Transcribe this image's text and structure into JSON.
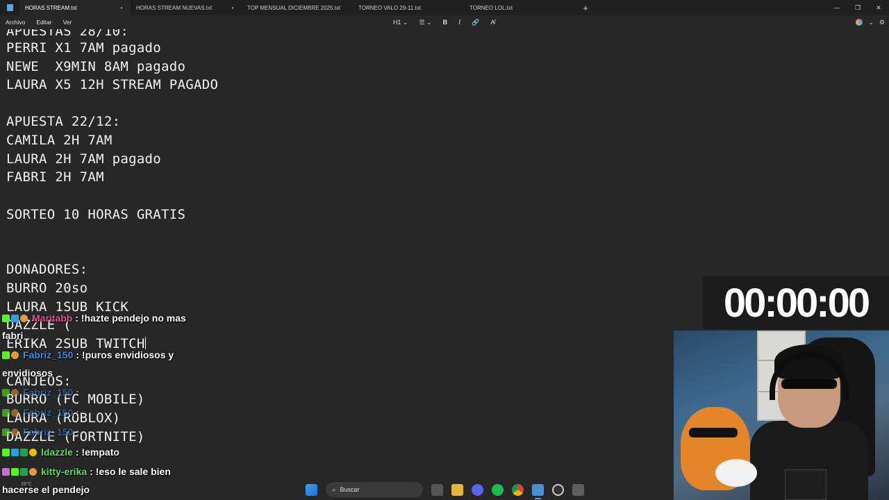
{
  "tabs": [
    {
      "label": "HORAS STREAM.txt",
      "unsaved": "•"
    },
    {
      "label": "HORAS STREAM NUEVAS.txt",
      "unsaved": "•"
    },
    {
      "label": "TOP MENSUAL DICIEMBRE 2025.txt",
      "unsaved": ""
    },
    {
      "label": "TORNEO VALO 29-11.txt",
      "unsaved": ""
    },
    {
      "label": "TORNEO LOL.txt",
      "unsaved": ""
    }
  ],
  "new_tab": "+",
  "window_controls": {
    "minimize": "—",
    "maximize": "❐",
    "close": "✕"
  },
  "menu": {
    "file": "Archivo",
    "edit": "Editar",
    "view": "Ver"
  },
  "format_toolbar": {
    "heading": "H1 ⌄",
    "list": "☰ ⌄",
    "bold": "B",
    "italic": "I",
    "link": "🔗",
    "clear": "A̸"
  },
  "right_toolbar": {
    "copilot_icon": "copilot-icon",
    "chevron": "⌄",
    "settings": "⚙"
  },
  "editor_lines": [
    "APUESTAS 28/10:",
    "PERRI X1 7AM pagado",
    "NEWE  X9MIN 8AM pagado",
    "LAURA X5 12H STREAM PAGADO",
    "",
    "APUESTA 22/12:",
    "CAMILA 2H 7AM",
    "LAURA 2H 7AM pagado",
    "FABRI 2H 7AM",
    "",
    "SORTEO 10 HORAS GRATIS",
    "",
    "",
    "DONADORES:",
    "BURRO 20so",
    "LAURA 1SUB KICK",
    "DAZZLE (",
    "ERIKA 2SUB TWITCH",
    "",
    "CANJEOS:",
    "BURRO (FC MOBILE)",
    "LAURA (ROBLOX)",
    "DAZZLE (FORTNITE)"
  ],
  "chat": [
    {
      "user": "Maritabb",
      "color": "#e0559a",
      "text": ": !hazte pendejo no mas",
      "wrap": "fabri"
    },
    {
      "user": "Fabriz_150",
      "color": "#3c8fe6",
      "text": ": !puros envidiosos y",
      "wrap": "envidiosos"
    },
    {
      "user": "Fabriz_150",
      "color": "#3c8fe6",
      "text": ":",
      "wrap": ""
    },
    {
      "user": "Fabriz_150",
      "color": "#3c8fe6",
      "text": ":",
      "wrap": ""
    },
    {
      "user": "Fabriz_150",
      "color": "#3c8fe6",
      "text": ":",
      "wrap": ""
    },
    {
      "user": "ldazzle",
      "color": "#5fe05a",
      "text": ": !empato",
      "wrap": ""
    },
    {
      "user": "kitty-erika",
      "color": "#5fe05a",
      "text": ": !eso le sale bien",
      "wrap": "hacerse el pendejo"
    }
  ],
  "timer": "00:00:00",
  "taskbar": {
    "search_placeholder": "Buscar",
    "weather": "18°C"
  }
}
